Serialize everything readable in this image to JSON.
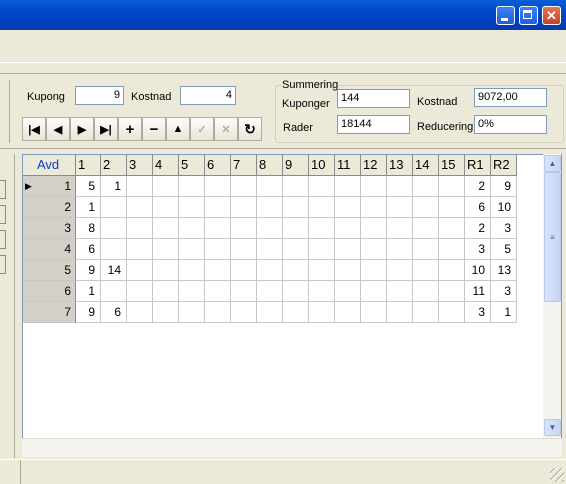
{
  "toolbar_top": {
    "kupong_label": "Kupong",
    "kupong_value": "9",
    "kostnad_label": "Kostnad",
    "kostnad_value": "4"
  },
  "summering": {
    "title": "Summering",
    "kuponger_label": "Kuponger",
    "kuponger_value": "144",
    "kostnad_label": "Kostnad",
    "kostnad_value": "9072,00",
    "rader_label": "Rader",
    "rader_value": "18144",
    "reducering_label": "Reducering",
    "reducering_value": "0%"
  },
  "nav_buttons": [
    {
      "name": "first-record-button",
      "glyph": "|◀",
      "enabled": true
    },
    {
      "name": "prior-record-button",
      "glyph": "◀",
      "enabled": true
    },
    {
      "name": "next-record-button",
      "glyph": "▶",
      "enabled": true
    },
    {
      "name": "last-record-button",
      "glyph": "▶|",
      "enabled": true
    },
    {
      "name": "insert-record-button",
      "glyph": "+",
      "enabled": true
    },
    {
      "name": "delete-record-button",
      "glyph": "−",
      "enabled": true
    },
    {
      "name": "edit-record-button",
      "glyph": "▲",
      "enabled": true
    },
    {
      "name": "post-edit-button",
      "glyph": "✓",
      "enabled": false
    },
    {
      "name": "cancel-edit-button",
      "glyph": "✕",
      "enabled": false
    },
    {
      "name": "refresh-data-button",
      "glyph": "↻",
      "enabled": true
    }
  ],
  "grid": {
    "headers": [
      "Avd",
      "1",
      "2",
      "3",
      "4",
      "5",
      "6",
      "7",
      "8",
      "9",
      "10",
      "11",
      "12",
      "13",
      "14",
      "15",
      "R1",
      "R2"
    ],
    "rows": [
      {
        "avd": "1",
        "c1": "5",
        "c2": "1",
        "r1": "2",
        "r2": "9",
        "current": true
      },
      {
        "avd": "2",
        "c1": "1",
        "c2": "",
        "r1": "6",
        "r2": "10",
        "current": false
      },
      {
        "avd": "3",
        "c1": "8",
        "c2": "",
        "r1": "2",
        "r2": "3",
        "current": false
      },
      {
        "avd": "4",
        "c1": "6",
        "c2": "",
        "r1": "3",
        "r2": "5",
        "current": false
      },
      {
        "avd": "5",
        "c1": "9",
        "c2": "14",
        "r1": "10",
        "r2": "13",
        "current": false
      },
      {
        "avd": "6",
        "c1": "1",
        "c2": "",
        "r1": "11",
        "r2": "3",
        "current": false
      },
      {
        "avd": "7",
        "c1": "9",
        "c2": "6",
        "r1": "3",
        "r2": "1",
        "current": false
      }
    ]
  },
  "colors": {
    "titlebar": "#0048c8",
    "header_text": "#0a3ccc",
    "fixed_col": "#d4d0c8"
  }
}
